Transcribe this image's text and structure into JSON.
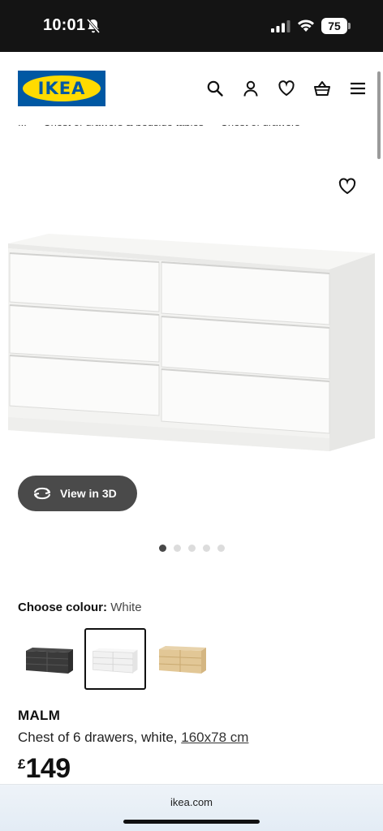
{
  "status_bar": {
    "time": "10:01",
    "battery_level": "75",
    "icons": [
      "bell-off-icon",
      "signal-icon",
      "wifi-icon",
      "battery-icon"
    ]
  },
  "header": {
    "logo_text": "IKEA",
    "icons": [
      "search-icon",
      "user-icon",
      "heart-icon",
      "basket-icon",
      "menu-icon"
    ],
    "brand_colors": {
      "blue": "#0058a3",
      "yellow": "#ffdb00"
    }
  },
  "breadcrumb": {
    "items": [
      "...",
      "Chest of drawers & bedside tables",
      "Chest of drawers"
    ],
    "separator": "›"
  },
  "product_image": {
    "favourite_icon": "heart-outline-icon",
    "view_3d_label": "View in 3D",
    "dots_count": 5,
    "active_dot": 1
  },
  "colour": {
    "label": "Choose colour:",
    "selected": "White",
    "options": [
      "Black-brown",
      "White",
      "White stained oak effect"
    ],
    "selected_index": 1
  },
  "product": {
    "name": "MALM",
    "description": "Chest of 6 drawers, white,",
    "size_link": "160x78 cm",
    "currency": "£",
    "price": "149"
  },
  "browser": {
    "url": "ikea.com"
  }
}
